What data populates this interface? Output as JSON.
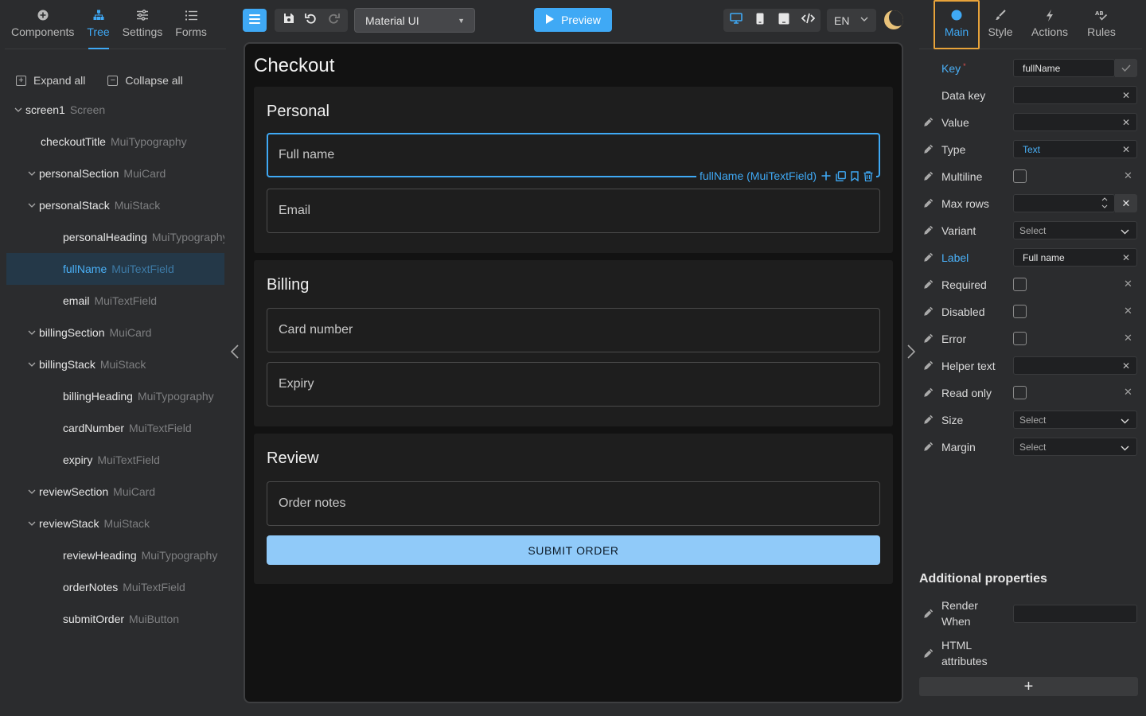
{
  "left_panel": {
    "tabs": [
      {
        "label": "Components",
        "icon": "plus-circle-icon"
      },
      {
        "label": "Tree",
        "icon": "tree-icon",
        "active": true
      },
      {
        "label": "Settings",
        "icon": "sliders-icon"
      },
      {
        "label": "Forms",
        "icon": "list-icon"
      }
    ],
    "expand_all": "Expand all",
    "collapse_all": "Collapse all",
    "tree": [
      {
        "name": "screen1",
        "type": "Screen",
        "level": 0,
        "expandable": true
      },
      {
        "name": "checkoutTitle",
        "type": "MuiTypography",
        "level": 1,
        "expandable": false
      },
      {
        "name": "personalSection",
        "type": "MuiCard",
        "level": 1,
        "expandable": true
      },
      {
        "name": "personalStack",
        "type": "MuiStack",
        "level": 2,
        "expandable": true
      },
      {
        "name": "personalHeading",
        "type": "MuiTypography",
        "level": 3,
        "expandable": false
      },
      {
        "name": "fullName",
        "type": "MuiTextField",
        "level": 3,
        "expandable": false,
        "selected": true
      },
      {
        "name": "email",
        "type": "MuiTextField",
        "level": 3,
        "expandable": false
      },
      {
        "name": "billingSection",
        "type": "MuiCard",
        "level": 1,
        "expandable": true
      },
      {
        "name": "billingStack",
        "type": "MuiStack",
        "level": 2,
        "expandable": true
      },
      {
        "name": "billingHeading",
        "type": "MuiTypography",
        "level": 3,
        "expandable": false
      },
      {
        "name": "cardNumber",
        "type": "MuiTextField",
        "level": 3,
        "expandable": false
      },
      {
        "name": "expiry",
        "type": "MuiTextField",
        "level": 3,
        "expandable": false
      },
      {
        "name": "reviewSection",
        "type": "MuiCard",
        "level": 1,
        "expandable": true
      },
      {
        "name": "reviewStack",
        "type": "MuiStack",
        "level": 2,
        "expandable": true
      },
      {
        "name": "reviewHeading",
        "type": "MuiTypography",
        "level": 3,
        "expandable": false
      },
      {
        "name": "orderNotes",
        "type": "MuiTextField",
        "level": 3,
        "expandable": false
      },
      {
        "name": "submitOrder",
        "type": "MuiButton",
        "level": 3,
        "expandable": false
      }
    ]
  },
  "toolbar": {
    "ui_kit": "Material UI",
    "preview_label": "Preview",
    "language": "EN"
  },
  "canvas": {
    "title": "Checkout",
    "selection_label": "fullName (MuiTextField)",
    "cards": [
      {
        "heading": "Personal",
        "fields": [
          "Full name",
          "Email"
        ]
      },
      {
        "heading": "Billing",
        "fields": [
          "Card number",
          "Expiry"
        ]
      },
      {
        "heading": "Review",
        "fields": [
          "Order notes"
        ],
        "button": "SUBMIT ORDER"
      }
    ]
  },
  "right_panel": {
    "tabs": [
      {
        "label": "Main",
        "icon": "circle-icon",
        "active": true
      },
      {
        "label": "Style",
        "icon": "brush-icon"
      },
      {
        "label": "Actions",
        "icon": "bolt-icon"
      },
      {
        "label": "Rules",
        "icon": "rules-icon"
      }
    ],
    "properties": [
      {
        "label": "Key",
        "kind": "input",
        "value": "fullName",
        "required": true,
        "confirm": true
      },
      {
        "label": "Data key",
        "kind": "input",
        "value": ""
      },
      {
        "label": "Value",
        "kind": "input",
        "value": "",
        "editable": true
      },
      {
        "label": "Type",
        "kind": "input",
        "value": "Text",
        "editable": true
      },
      {
        "label": "Multiline",
        "kind": "checkbox",
        "editable": true
      },
      {
        "label": "Max rows",
        "kind": "number",
        "value": "",
        "editable": true
      },
      {
        "label": "Variant",
        "kind": "select",
        "value": "Select",
        "editable": true
      },
      {
        "label": "Label",
        "kind": "input",
        "value": "Full name",
        "editable": true,
        "highlight": true
      },
      {
        "label": "Required",
        "kind": "checkbox",
        "editable": true
      },
      {
        "label": "Disabled",
        "kind": "checkbox",
        "editable": true
      },
      {
        "label": "Error",
        "kind": "checkbox",
        "editable": true
      },
      {
        "label": "Helper text",
        "kind": "input",
        "value": "",
        "editable": true
      },
      {
        "label": "Read only",
        "kind": "checkbox",
        "editable": true
      },
      {
        "label": "Size",
        "kind": "select",
        "value": "Select",
        "editable": true
      },
      {
        "label": "Margin",
        "kind": "select",
        "value": "Select",
        "editable": true
      }
    ],
    "additional_title": "Additional properties",
    "additional": [
      {
        "line1": "Render",
        "line2": "When"
      },
      {
        "line1": "HTML",
        "line2": "attributes"
      }
    ],
    "add_label": "+"
  },
  "colors": {
    "accent": "#3fa9f5",
    "selected_tab_outline": "#e8a33a",
    "button_fill": "#90caf9",
    "canvas_bg": "#121212",
    "card_bg": "#1e1e1e",
    "panel_bg": "#2b2c2e"
  }
}
